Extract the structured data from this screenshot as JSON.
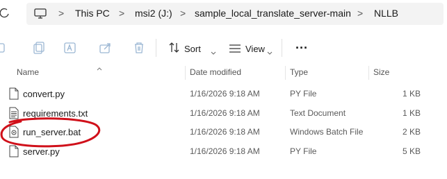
{
  "breadcrumb": {
    "items": [
      "This PC",
      "msi2 (J:)",
      "sample_local_translate_server-main",
      "NLLB"
    ],
    "separator": ">"
  },
  "toolbar": {
    "sort_label": "Sort",
    "view_label": "View",
    "more_label": "···"
  },
  "columns": {
    "name": "Name",
    "date_modified": "Date modified",
    "type": "Type",
    "size": "Size"
  },
  "files": [
    {
      "name": "convert.py",
      "date": "1/16/2026 9:18 AM",
      "type": "PY File",
      "size": "1 KB",
      "icon": "python-file-icon"
    },
    {
      "name": "requirements.txt",
      "date": "1/16/2026 9:18 AM",
      "type": "Text Document",
      "size": "1 KB",
      "icon": "text-file-icon"
    },
    {
      "name": "run_server.bat",
      "date": "1/16/2026 9:18 AM",
      "type": "Windows Batch File",
      "size": "2 KB",
      "icon": "batch-file-icon"
    },
    {
      "name": "server.py",
      "date": "1/16/2026 9:18 AM",
      "type": "PY File",
      "size": "5 KB",
      "icon": "python-file-icon"
    }
  ],
  "colors": {
    "annotation_ellipse": "#d0101a",
    "toolbar_icon_disabled": "#9bb6d3"
  }
}
